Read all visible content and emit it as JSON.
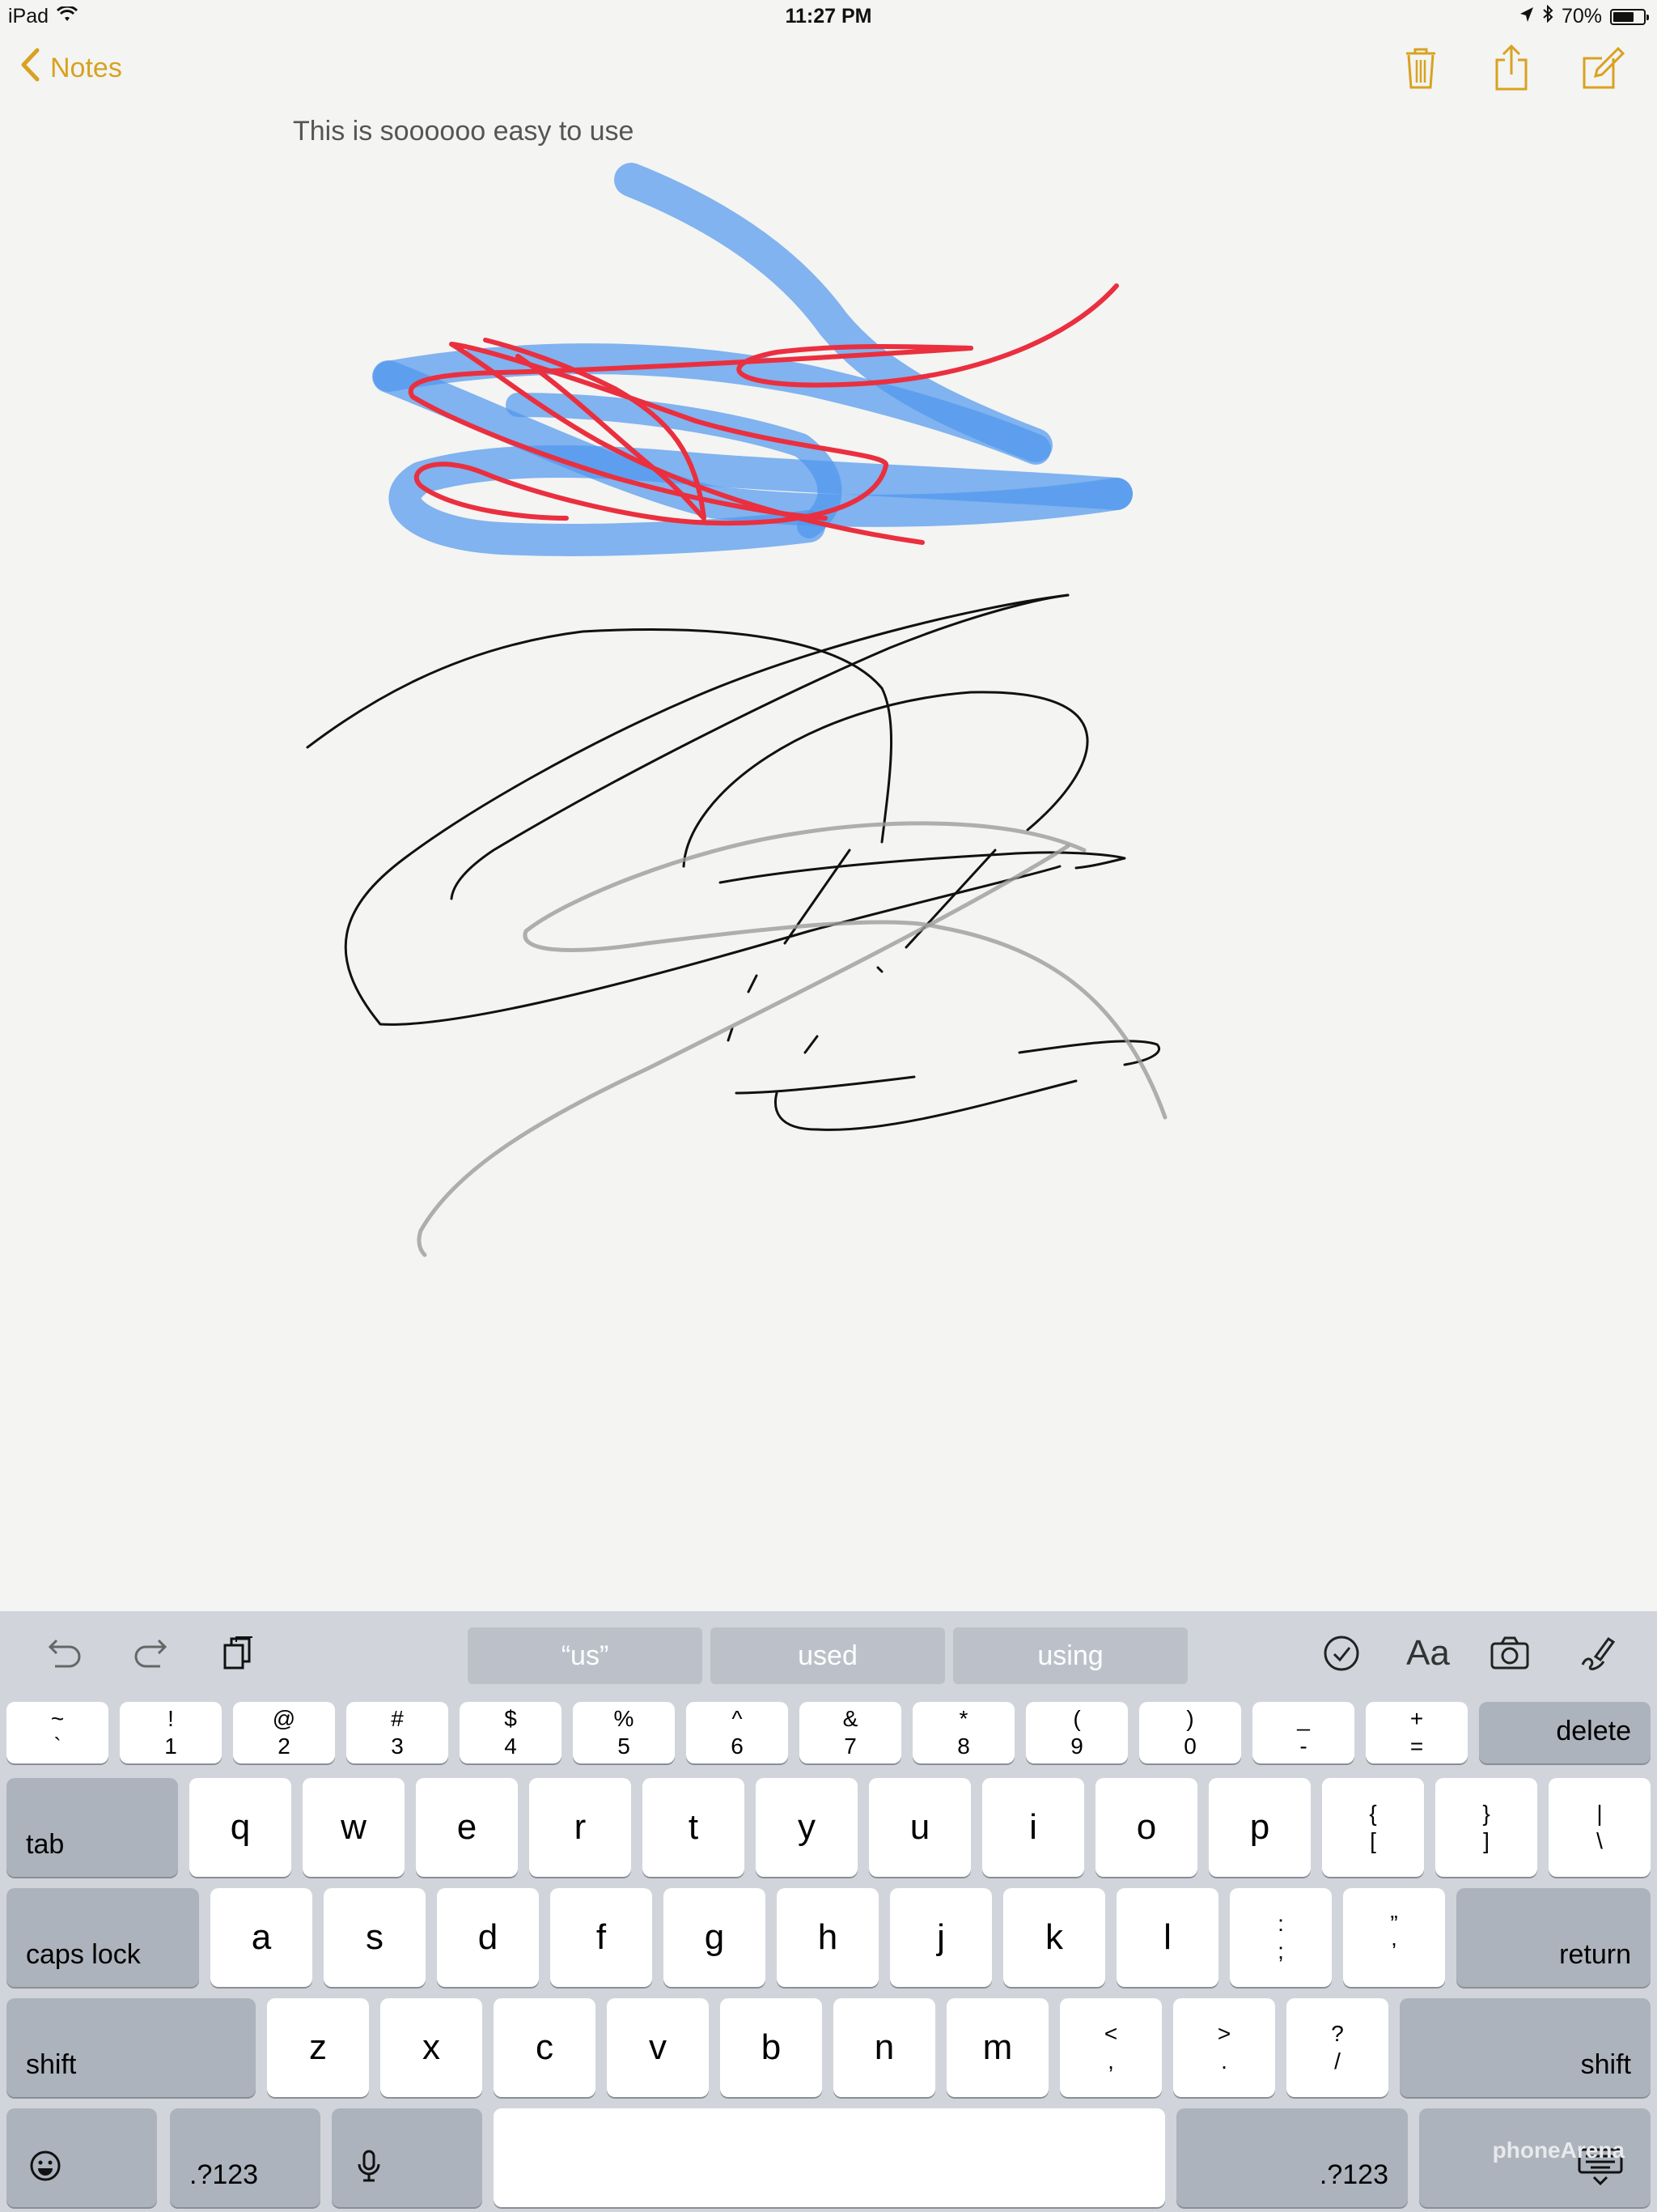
{
  "status_bar": {
    "device": "iPad",
    "time": "11:27 PM",
    "battery": "70%",
    "battery_level": 0.7
  },
  "nav": {
    "back_label": "Notes",
    "accent_color": "#d8a221",
    "icons": [
      "chevron-left-icon",
      "trash-icon",
      "share-icon",
      "compose-icon"
    ]
  },
  "note": {
    "text": "This is soooooo easy to use"
  },
  "keyboard": {
    "suggestions": [
      "“us”",
      "used",
      "using"
    ],
    "format_label": "Aa",
    "number_row": [
      {
        "top": "~",
        "bottom": "`"
      },
      {
        "top": "!",
        "bottom": "1"
      },
      {
        "top": "@",
        "bottom": "2"
      },
      {
        "top": "#",
        "bottom": "3"
      },
      {
        "top": "$",
        "bottom": "4"
      },
      {
        "top": "%",
        "bottom": "5"
      },
      {
        "top": "^",
        "bottom": "6"
      },
      {
        "top": "&",
        "bottom": "7"
      },
      {
        "top": "*",
        "bottom": "8"
      },
      {
        "top": "(",
        "bottom": "9"
      },
      {
        "top": ")",
        "bottom": "0"
      },
      {
        "top": "_",
        "bottom": "-"
      },
      {
        "top": "+",
        "bottom": "="
      }
    ],
    "delete_label": "delete",
    "tab_label": "tab",
    "row_q": [
      "q",
      "w",
      "e",
      "r",
      "t",
      "y",
      "u",
      "i",
      "o",
      "p"
    ],
    "row_q_symbols": [
      {
        "top": "{",
        "bottom": "["
      },
      {
        "top": "}",
        "bottom": "]"
      },
      {
        "top": "|",
        "bottom": "\\"
      }
    ],
    "caps_label": "caps lock",
    "row_a": [
      "a",
      "s",
      "d",
      "f",
      "g",
      "h",
      "j",
      "k",
      "l"
    ],
    "row_a_symbols": [
      {
        "top": ":",
        "bottom": ";"
      },
      {
        "top": "”",
        "bottom": "’"
      }
    ],
    "return_label": "return",
    "shift_label": "shift",
    "row_z": [
      "z",
      "x",
      "c",
      "v",
      "b",
      "n",
      "m"
    ],
    "row_z_symbols": [
      {
        "top": "<",
        "bottom": ","
      },
      {
        "top": ">",
        "bottom": "."
      },
      {
        "top": "?",
        "bottom": "/"
      }
    ],
    "numbers_label": ".?123",
    "watermark": "phoneArena"
  }
}
